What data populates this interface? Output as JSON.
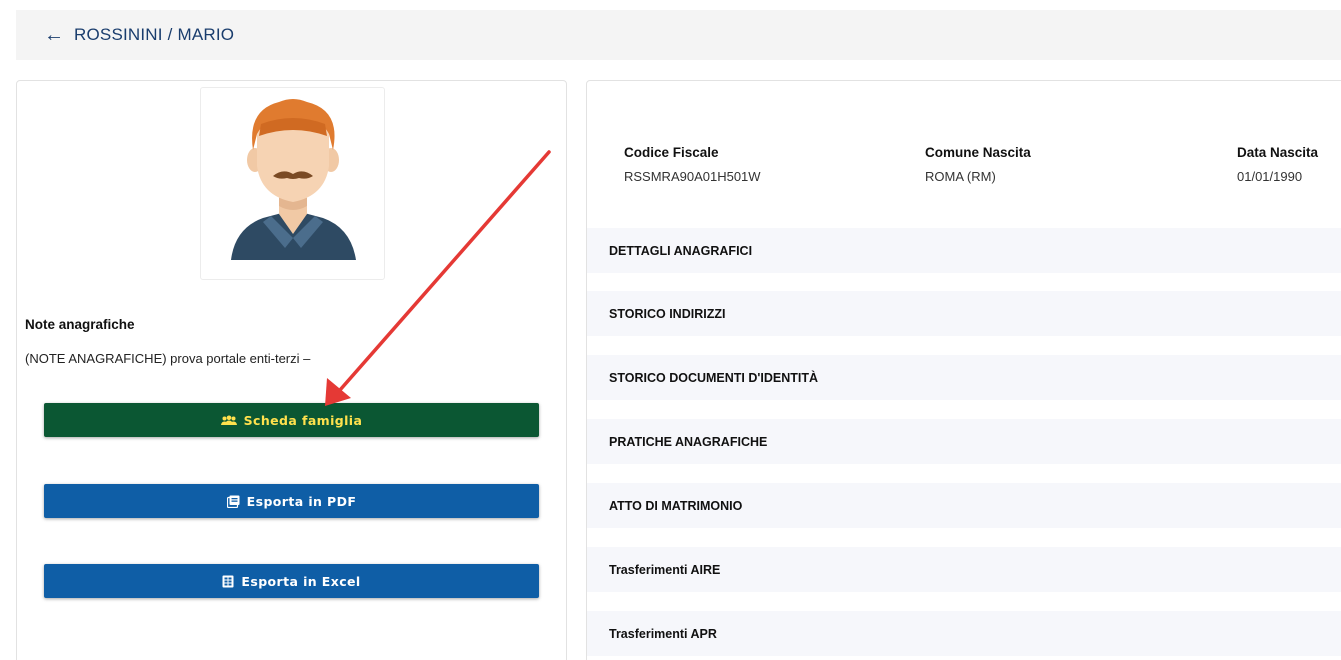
{
  "header": {
    "back_icon": "arrow-left-icon",
    "title": "ROSSININI / MARIO"
  },
  "left_panel": {
    "avatar_icon": "male-avatar-icon",
    "notes_title": "Note anagrafiche",
    "notes_text": "(NOTE ANAGRAFICHE) prova portale enti-terzi –",
    "buttons": {
      "family": {
        "label": "Scheda famiglia",
        "icon": "people-group-icon"
      },
      "pdf": {
        "label": "Esporta in PDF",
        "icon": "pdf-file-icon"
      },
      "excel": {
        "label": "Esporta in Excel",
        "icon": "excel-file-icon"
      }
    }
  },
  "summary": {
    "codice_fiscale": {
      "label": "Codice Fiscale",
      "value": "RSSMRA90A01H501W"
    },
    "comune_nascita": {
      "label": "Comune Nascita",
      "value": "ROMA (RM)"
    },
    "data_nascita": {
      "label": "Data Nascita",
      "value": "01/01/1990"
    }
  },
  "sections": [
    {
      "label": "DETTAGLI ANAGRAFICI"
    },
    {
      "label": "STORICO INDIRIZZI"
    },
    {
      "label": "STORICO DOCUMENTI D'IDENTITÀ"
    },
    {
      "label": "PRATICHE ANAGRAFICHE"
    },
    {
      "label": "ATTO DI MATRIMONIO"
    },
    {
      "label": "Trasferimenti AIRE"
    },
    {
      "label": "Trasferimenti APR"
    }
  ],
  "colors": {
    "annotation_arrow": "#e53935",
    "family_button": "#0b5733",
    "family_button_text": "#ffe14d",
    "export_button": "#0f5ea6",
    "title_text": "#1a3d6d"
  }
}
